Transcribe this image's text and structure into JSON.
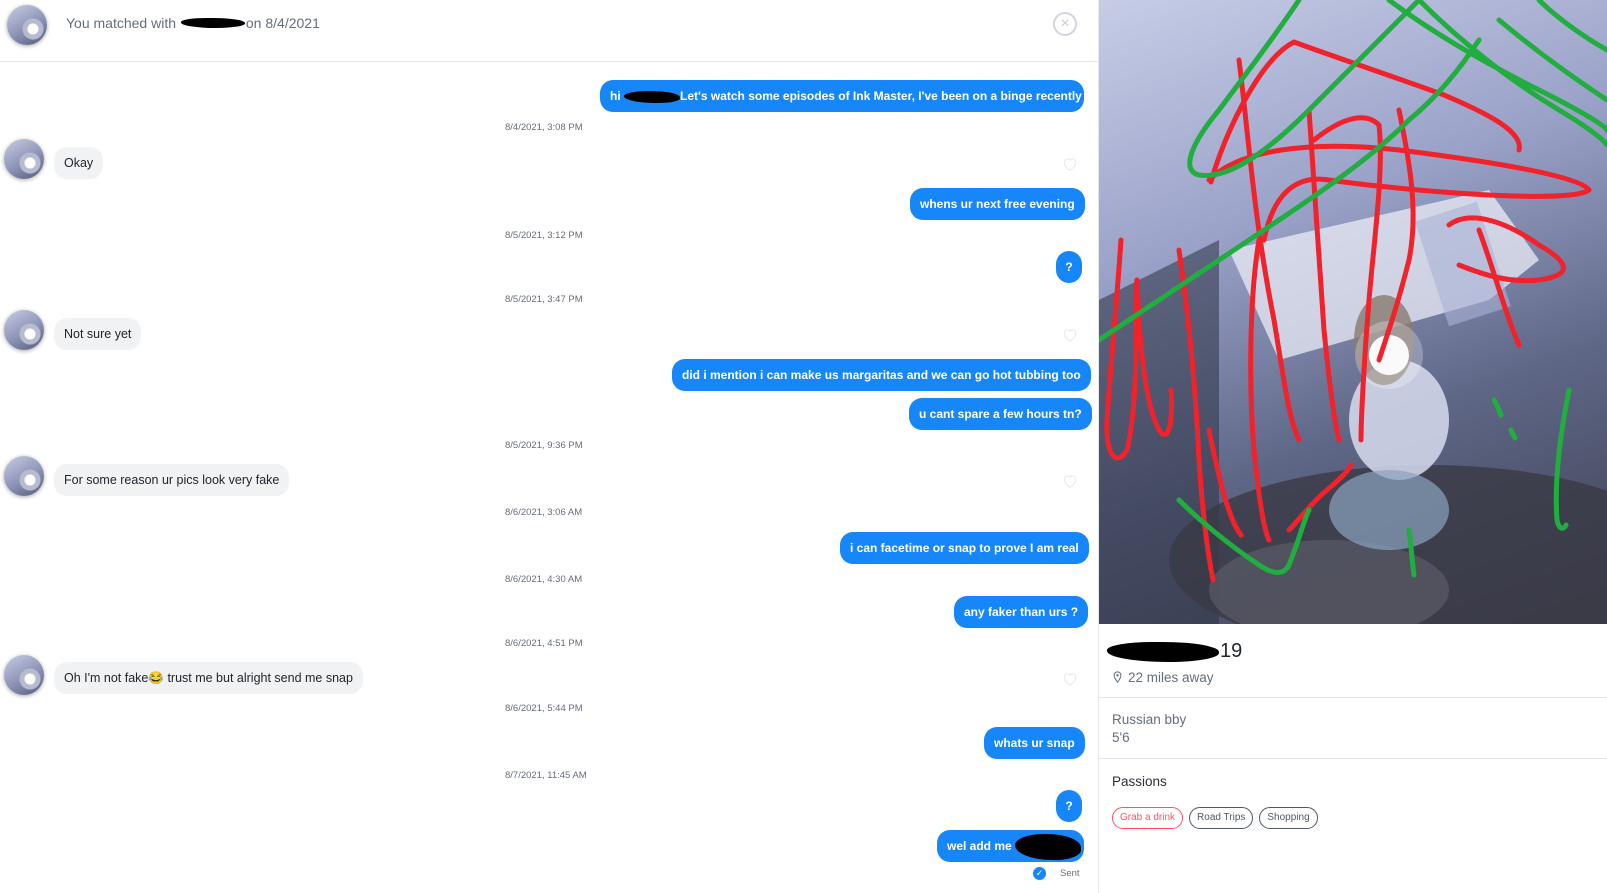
{
  "header": {
    "match_prefix": "You matched with",
    "match_suffix": "on 8/4/2021"
  },
  "messages": [
    {
      "dir": "out",
      "pre": "hi",
      "text": "Let's watch some episodes of Ink Master, I've been on a binge recently"
    },
    {
      "ts": "8/4/2021, 3:08 PM"
    },
    {
      "dir": "in",
      "text": "Okay"
    },
    {
      "dir": "out",
      "text": "whens ur next free evening"
    },
    {
      "ts": "8/5/2021, 3:12 PM"
    },
    {
      "dir": "out",
      "text": "?"
    },
    {
      "ts": "8/5/2021, 3:47 PM"
    },
    {
      "dir": "in",
      "text": "Not sure yet"
    },
    {
      "dir": "out",
      "text": "did i mention i can make us margaritas and we can go hot tubbing too"
    },
    {
      "dir": "out",
      "text": "u cant spare a few hours tn?"
    },
    {
      "ts": "8/5/2021, 9:36 PM"
    },
    {
      "dir": "in",
      "text": "For some reason ur pics look very fake"
    },
    {
      "ts": "8/6/2021, 3:06 AM"
    },
    {
      "dir": "out",
      "text": "i can facetime or snap to prove I am real"
    },
    {
      "ts": "8/6/2021, 4:30 AM"
    },
    {
      "dir": "out",
      "text": "any faker than urs ?"
    },
    {
      "ts": "8/6/2021, 4:51 PM"
    },
    {
      "dir": "in",
      "pre": "Oh I'm not fake",
      "text": "trust me but alright send me snap",
      "emoji": "😂"
    },
    {
      "ts": "8/6/2021, 5:44 PM"
    },
    {
      "dir": "out",
      "text": "whats ur snap"
    },
    {
      "ts": "8/7/2021, 11:45 AM"
    },
    {
      "dir": "out",
      "text": "?"
    },
    {
      "dir": "out",
      "text": "wel add me"
    }
  ],
  "sent_status": "Sent",
  "profile": {
    "age": "19",
    "distance": "22 miles away",
    "bio_line1": "Russian bby",
    "bio_line2": "5'6",
    "passions_title": "Passions",
    "passions": [
      {
        "label": "Grab a drink",
        "shared": true
      },
      {
        "label": "Road Trips",
        "shared": false
      },
      {
        "label": "Shopping",
        "shared": false
      }
    ]
  },
  "colors": {
    "brand_blue": "#1786f8",
    "brand_pink": "#fd5068",
    "scribble_red": "#f0222b",
    "scribble_green": "#21ad3f"
  },
  "icons": [
    "close-icon",
    "heart-icon",
    "location-pin-icon",
    "sent-check-icon"
  ]
}
